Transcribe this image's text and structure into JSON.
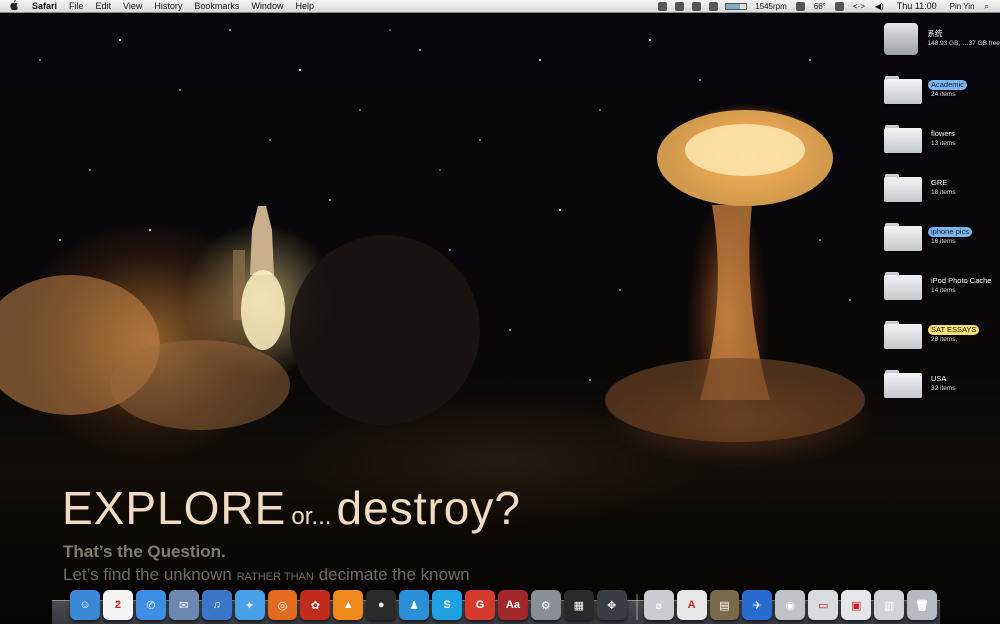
{
  "menubar": {
    "apple": "",
    "app_name": "Safari",
    "menus": [
      "File",
      "Edit",
      "View",
      "History",
      "Bookmarks",
      "Window",
      "Help"
    ],
    "status": {
      "fan_speed": "1545rpm",
      "temperature": "66°",
      "clock": "Thu 11:00",
      "user": "Pin Yin"
    }
  },
  "desktop": {
    "disk": {
      "name": "系统",
      "info": "148.93 GB, …37 GB free"
    },
    "folders": [
      {
        "name": "Academic",
        "count": "24 items",
        "label": "blue"
      },
      {
        "name": "flowers",
        "count": "13 items",
        "label": "none"
      },
      {
        "name": "GRE",
        "count": "18 items",
        "label": "none"
      },
      {
        "name": "iphone pics",
        "count": "16 items",
        "label": "blue"
      },
      {
        "name": "iPod Photo Cache",
        "count": "14 items",
        "label": "none"
      },
      {
        "name": "SAT ESSAYS",
        "count": "28 items,",
        "label": "yellow"
      },
      {
        "name": "USA",
        "count": "32 items",
        "label": "none"
      }
    ]
  },
  "wallpaper": {
    "headline_big": "EXPLORE",
    "headline_small": "or...",
    "headline_end": "destroy?",
    "question": "That’s the Question.",
    "sub_a": "Let’s find the unknown",
    "sub_caps": "RATHER THAN",
    "sub_b": "decimate the known"
  },
  "dock": {
    "items": [
      {
        "name": "finder-icon",
        "glyph": "☺",
        "color": "#3c88d8"
      },
      {
        "name": "ical-icon",
        "glyph": "2",
        "color": "#f4f4f4"
      },
      {
        "name": "ichat-icon",
        "glyph": "✆",
        "color": "#3f8ee6"
      },
      {
        "name": "mail-icon",
        "glyph": "✉",
        "color": "#6c87b0"
      },
      {
        "name": "itunes-icon",
        "glyph": "♫",
        "color": "#3b77c9"
      },
      {
        "name": "safari-icon",
        "glyph": "✦",
        "color": "#4aa0e8"
      },
      {
        "name": "firefox-icon",
        "glyph": "◎",
        "color": "#e26b1f"
      },
      {
        "name": "transmission-icon",
        "glyph": "✿",
        "color": "#c22c1c"
      },
      {
        "name": "vlc-icon",
        "glyph": "▲",
        "color": "#f08a1c"
      },
      {
        "name": "qq-icon",
        "glyph": "●",
        "color": "#2a2a2a"
      },
      {
        "name": "messenger-icon",
        "glyph": "♟",
        "color": "#2b8fd8"
      },
      {
        "name": "skype-icon",
        "glyph": "S",
        "color": "#1ea0e2"
      },
      {
        "name": "app-store-icon",
        "glyph": "G",
        "color": "#d53a2f"
      },
      {
        "name": "dictionary-icon",
        "glyph": "Aa",
        "color": "#a2282a"
      },
      {
        "name": "system-preferences-icon",
        "glyph": "⚙",
        "color": "#8a8e95"
      },
      {
        "name": "final-cut-icon",
        "glyph": "▦",
        "color": "#2a2a2a"
      },
      {
        "name": "spaces-icon",
        "glyph": "✥",
        "color": "#3a3d44"
      },
      {
        "name": "separator",
        "glyph": "",
        "color": ""
      },
      {
        "name": "utility-icon",
        "glyph": "⌀",
        "color": "#c9ccd1"
      },
      {
        "name": "acrobat-icon",
        "glyph": "A",
        "color": "#e8e8e8"
      },
      {
        "name": "keynote-icon",
        "glyph": "▤",
        "color": "#7b6a4a"
      },
      {
        "name": "xcode-icon",
        "glyph": "✈",
        "color": "#2a6bd0"
      },
      {
        "name": "dvd-player-icon",
        "glyph": "◉",
        "color": "#bfc3c8"
      },
      {
        "name": "documents-stack-icon",
        "glyph": "▭",
        "color": "#d9dbde"
      },
      {
        "name": "downloads-stack-icon",
        "glyph": "▣",
        "color": "#e4e6ea"
      },
      {
        "name": "screenshot-stack-icon",
        "glyph": "▥",
        "color": "#cfd2d6"
      },
      {
        "name": "trash-icon",
        "glyph": "🗑",
        "color": "#b8bcc2"
      }
    ]
  }
}
